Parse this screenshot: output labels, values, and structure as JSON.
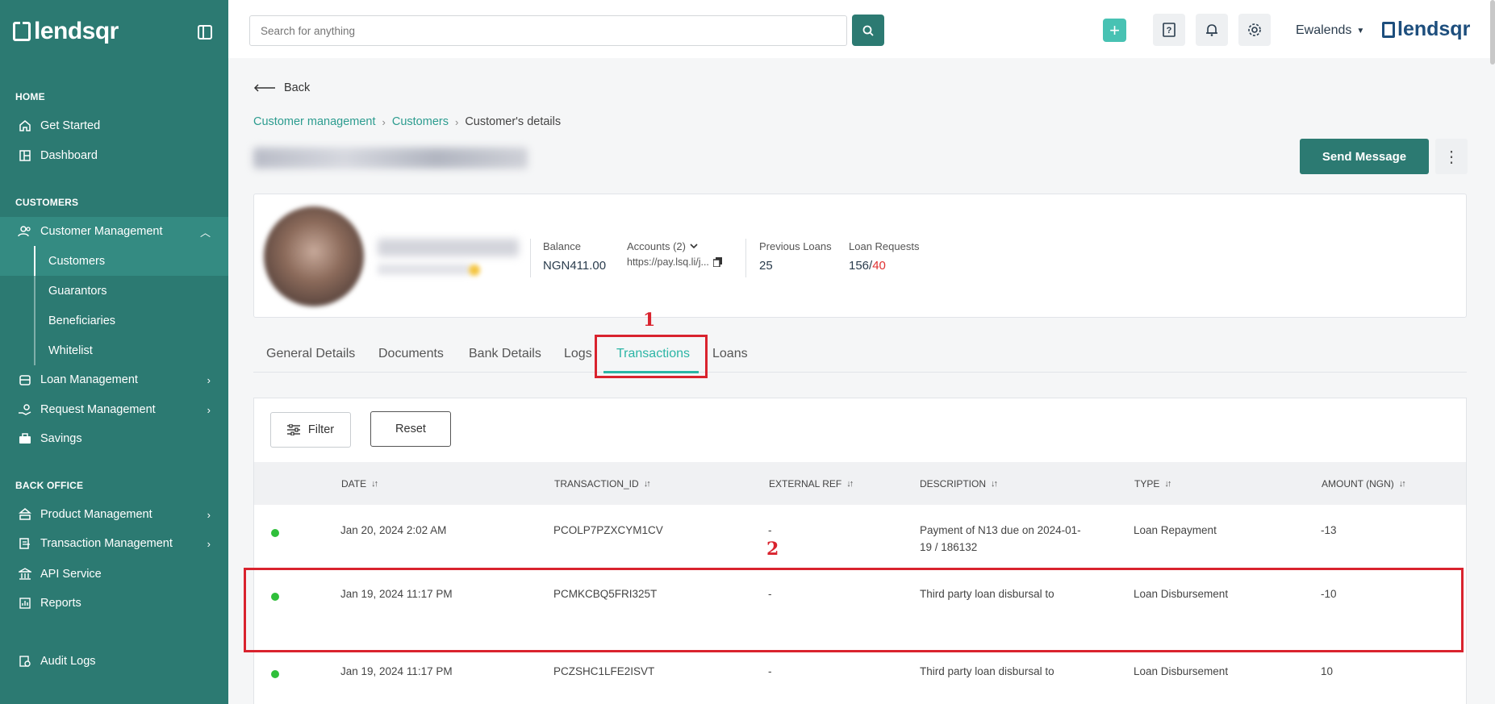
{
  "sidebar": {
    "logo": "lendsqr",
    "sections": {
      "home": "HOME",
      "customers": "CUSTOMERS",
      "back_office": "BACK OFFICE"
    },
    "items": {
      "get_started": "Get Started",
      "dashboard": "Dashboard",
      "customer_management": "Customer Management",
      "customers": "Customers",
      "guarantors": "Guarantors",
      "beneficiaries": "Beneficiaries",
      "whitelist": "Whitelist",
      "loan_management": "Loan Management",
      "request_management": "Request Management",
      "savings": "Savings",
      "product_management": "Product Management",
      "transaction_management": "Transaction Management",
      "api_service": "API Service",
      "reports": "Reports",
      "audit_logs": "Audit Logs"
    }
  },
  "topbar": {
    "search_placeholder": "Search for anything",
    "user": "Ewalends",
    "brand": "lendsqr"
  },
  "page": {
    "back": "Back",
    "breadcrumb": [
      "Customer management",
      "Customers",
      "Customer's details"
    ],
    "send_message": "Send Message"
  },
  "profile": {
    "balance_label": "Balance",
    "balance_value": "NGN411.00",
    "accounts_label": "Accounts (2)",
    "accounts_link": "https://pay.lsq.li/j...",
    "previous_loans_label": "Previous Loans",
    "previous_loans_value": "25",
    "loan_requests_label": "Loan Requests",
    "loan_requests_value": "156/",
    "loan_requests_red": "40"
  },
  "tabs": [
    "General Details",
    "Documents",
    "Bank Details",
    "Logs",
    "Transactions",
    "Loans"
  ],
  "annotations": {
    "n1": "1",
    "n2": "2"
  },
  "table": {
    "filter": "Filter",
    "reset": "Reset",
    "headers": [
      "DATE",
      "TRANSACTION_ID",
      "EXTERNAL REF",
      "DESCRIPTION",
      "TYPE",
      "AMOUNT (NGN)"
    ],
    "rows": [
      {
        "date": "Jan 20, 2024 2:02 AM",
        "id": "PCOLP7PZXCYM1CV",
        "ref": "-",
        "desc1": "Payment of N13 due on 2024-01-",
        "desc2": "19 / 186132",
        "type": "Loan Repayment",
        "amount": "-13"
      },
      {
        "date": "Jan 19, 2024 11:17 PM",
        "id": "PCMKCBQ5FRI325T",
        "ref": "-",
        "desc1": "Third party loan disbursal to",
        "desc2": "",
        "type": "Loan Disbursement",
        "amount": "-10"
      },
      {
        "date": "Jan 19, 2024 11:17 PM",
        "id": "PCZSHC1LFE2ISVT",
        "ref": "-",
        "desc1": "Third party loan disbursal to",
        "desc2": "",
        "type": "Loan Disbursement",
        "amount": "10"
      }
    ]
  },
  "colors": {
    "primary": "#2c7a72",
    "accent": "#2cb5a5",
    "annotation": "#d9232e",
    "status_dot": "#2fbf3a"
  }
}
